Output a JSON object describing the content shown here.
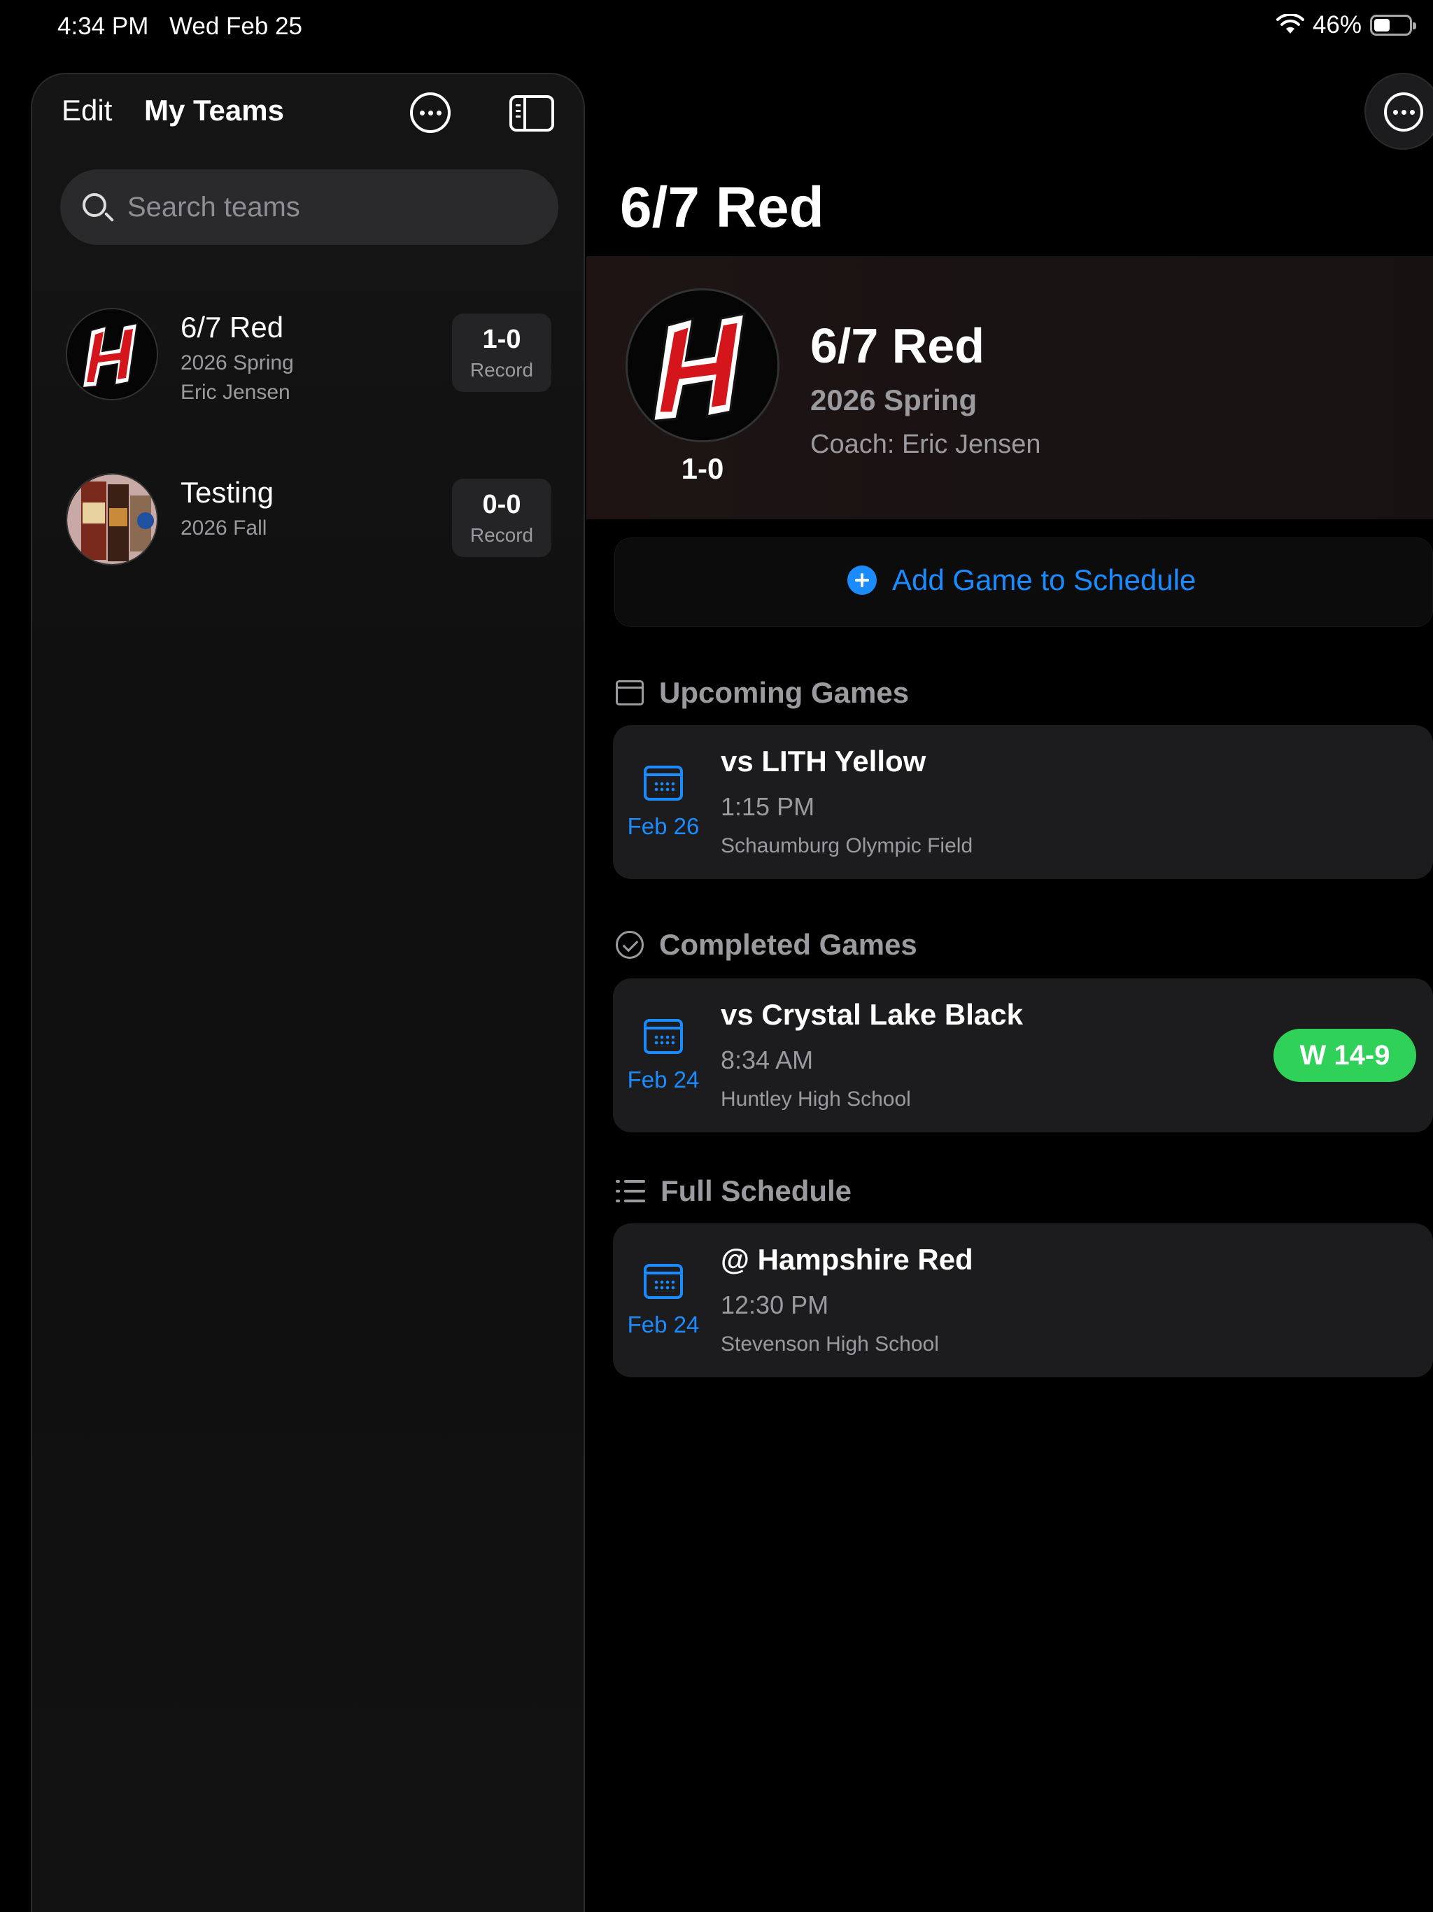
{
  "status_bar": {
    "time": "4:34 PM",
    "date": "Wed Feb 25",
    "battery": "46%",
    "battery_level": 0.46,
    "icons": [
      "wifi-icon",
      "battery-icon"
    ]
  },
  "sidebar": {
    "edit_label": "Edit",
    "title": "My Teams",
    "search_placeholder": "Search teams",
    "teams": [
      {
        "name": "6/7 Red",
        "season": "2026 Spring",
        "coach": "Eric Jensen",
        "record": "1-0",
        "record_label": "Record"
      },
      {
        "name": "Testing",
        "season": "2026 Fall",
        "coach": "",
        "record": "0-0",
        "record_label": "Record"
      }
    ]
  },
  "main": {
    "title": "6/7 Red",
    "hero": {
      "name": "6/7 Red",
      "season": "2026 Spring",
      "coach": "Coach: Eric Jensen",
      "record": "1-0"
    },
    "add_game_label": "Add Game to Schedule",
    "sections": {
      "upcoming": "Upcoming Games",
      "completed": "Completed Games",
      "full": "Full Schedule"
    },
    "upcoming_games": [
      {
        "date": "Feb 26",
        "opponent": "vs LITH Yellow",
        "time": "1:15 PM",
        "location": "Schaumburg Olympic Field"
      }
    ],
    "completed_games": [
      {
        "date": "Feb 24",
        "opponent": "vs Crystal Lake Black",
        "time": "8:34 AM",
        "location": "Huntley High School",
        "result": "W 14-9"
      }
    ],
    "full_schedule": [
      {
        "date": "Feb 24",
        "opponent": "@ Hampshire Red",
        "time": "12:30 PM",
        "location": "Stevenson High School"
      }
    ]
  },
  "colors": {
    "accent": "#1a8cff",
    "win": "#30d158",
    "secondary_text": "#9a9a9f",
    "logo_red": "#d4161c"
  }
}
